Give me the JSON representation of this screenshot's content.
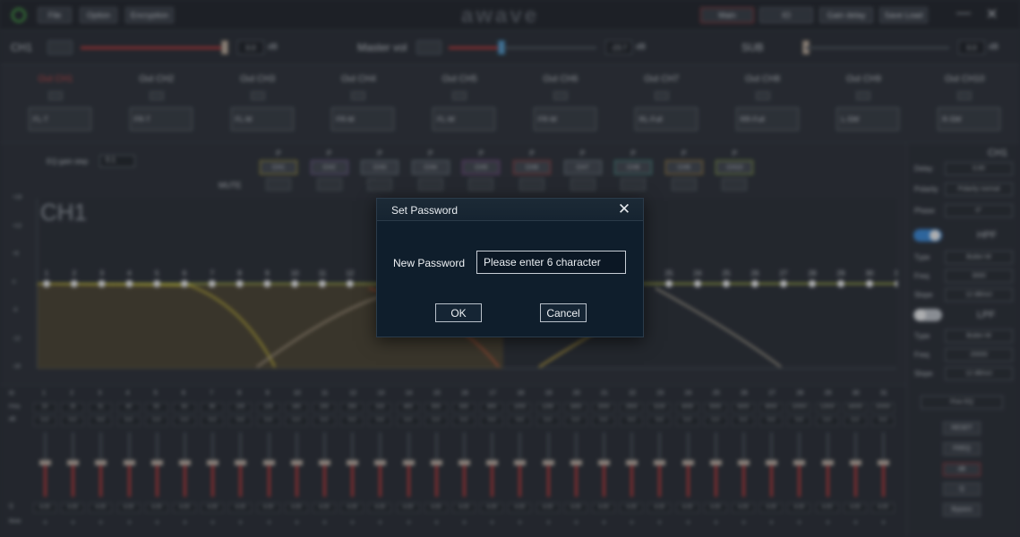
{
  "topbar": {
    "menus": [
      "File",
      "Option",
      "Encryption"
    ],
    "logo": "awave",
    "nav": [
      "Main",
      "IO",
      "Gain delay",
      "Save Load"
    ],
    "minimize": "—",
    "close": "✕"
  },
  "volume": {
    "ch1": {
      "label": "CH1",
      "value": "0.0",
      "unit": "dB",
      "level": 1.0
    },
    "master": {
      "label": "Master vol",
      "value": "-23.7",
      "unit": "dB",
      "level": 0.35
    },
    "sub": {
      "label": "SUB",
      "value": "0.0",
      "unit": "dB",
      "level": 0.0
    }
  },
  "outputs": [
    {
      "name": "Out CH1",
      "type": "FL-T",
      "active": true
    },
    {
      "name": "Out CH2",
      "type": "FR-T"
    },
    {
      "name": "Out CH3",
      "type": "FL-M"
    },
    {
      "name": "Out CH4",
      "type": "FR-M"
    },
    {
      "name": "Out CH5",
      "type": "FL-W"
    },
    {
      "name": "Out CH6",
      "type": "FR-W"
    },
    {
      "name": "Out CH7",
      "type": "RL-Full"
    },
    {
      "name": "Out CH8",
      "type": "RR-Full"
    },
    {
      "name": "Out CH9",
      "type": "L-SW"
    },
    {
      "name": "Out CH10",
      "type": "R-SW"
    }
  ],
  "eq": {
    "gain_step_label": "EQ gain step",
    "gain_step_value": "0.1",
    "mute_label": "MUTE",
    "channel_title": "CH1",
    "channels": [
      "CH1",
      "CH2",
      "CH3",
      "CH4",
      "CH5",
      "CH6",
      "CH7",
      "CH8",
      "CH9",
      "CH10"
    ],
    "phase_marker": "P",
    "channel_colors": [
      "#c7b33a",
      "#8c6bb0",
      "#7f8a94",
      "#7f8a94",
      "#9a4fa6",
      "#c04040",
      "#7f8a94",
      "#4fa69a",
      "#c99a3c",
      "#a6c04a"
    ],
    "y_ticks": [
      "+18",
      "+12",
      "+6",
      "0",
      "-6",
      "-12",
      "-18"
    ],
    "point_labels": [
      "1",
      "2",
      "3",
      "4",
      "5",
      "6",
      "7",
      "8",
      "9",
      "10",
      "11",
      "12",
      "25",
      "24",
      "25",
      "26",
      "27",
      "28",
      "29",
      "30",
      "31"
    ]
  },
  "right_panel": {
    "title": "CH1",
    "delay_label": "Delay",
    "delay_value": "0.00",
    "polarity_label": "Polarity",
    "polarity_value": "Polarity normal",
    "phase_label": "Phase",
    "phase_value": "0°",
    "hpf_label": "HPF",
    "hpf_on": true,
    "hpf_type_label": "Type",
    "hpf_type": "Butter-W",
    "hpf_freq_label": "Freq",
    "hpf_freq": "3000",
    "hpf_slope_label": "Slope",
    "hpf_slope": "12 dB/oct",
    "lpf_label": "LPF",
    "lpf_on": false,
    "lpf_type_label": "Type",
    "lpf_type": "Butter-W",
    "lpf_freq_label": "Freq",
    "lpf_freq": "20000",
    "lpf_slope_label": "Slope",
    "lpf_slope": "12 dB/oct",
    "eq_mode": "Fine EQ",
    "buttons": [
      "RESET",
      "FREQ",
      "dB",
      "Q",
      "Bypass"
    ]
  },
  "bands": {
    "row_labels": [
      "ID",
      "F/Hz",
      "dB",
      "Q",
      "Mute"
    ],
    "ids": [
      "1",
      "2",
      "3",
      "4",
      "5",
      "6",
      "7",
      "8",
      "9",
      "10",
      "11",
      "12",
      "13",
      "14",
      "15",
      "16",
      "17",
      "18",
      "19",
      "20",
      "21",
      "22",
      "23",
      "24",
      "25",
      "26",
      "27",
      "28",
      "29",
      "30",
      "31"
    ],
    "freqs": [
      "20",
      "25",
      "31",
      "40",
      "50",
      "63",
      "80",
      "100",
      "125",
      "160",
      "200",
      "250",
      "315",
      "400",
      "500",
      "630",
      "800",
      "1000",
      "1250",
      "1600",
      "2000",
      "2500",
      "3150",
      "4000",
      "5000",
      "6300",
      "8000",
      "10000",
      "12500",
      "16000",
      "20000"
    ],
    "gain": "0.0",
    "q": "4.00"
  },
  "dialog": {
    "title": "Set Password",
    "close_icon": "✕",
    "field_label": "New Password",
    "placeholder": "Please enter 6 character",
    "ok": "OK",
    "cancel": "Cancel"
  }
}
